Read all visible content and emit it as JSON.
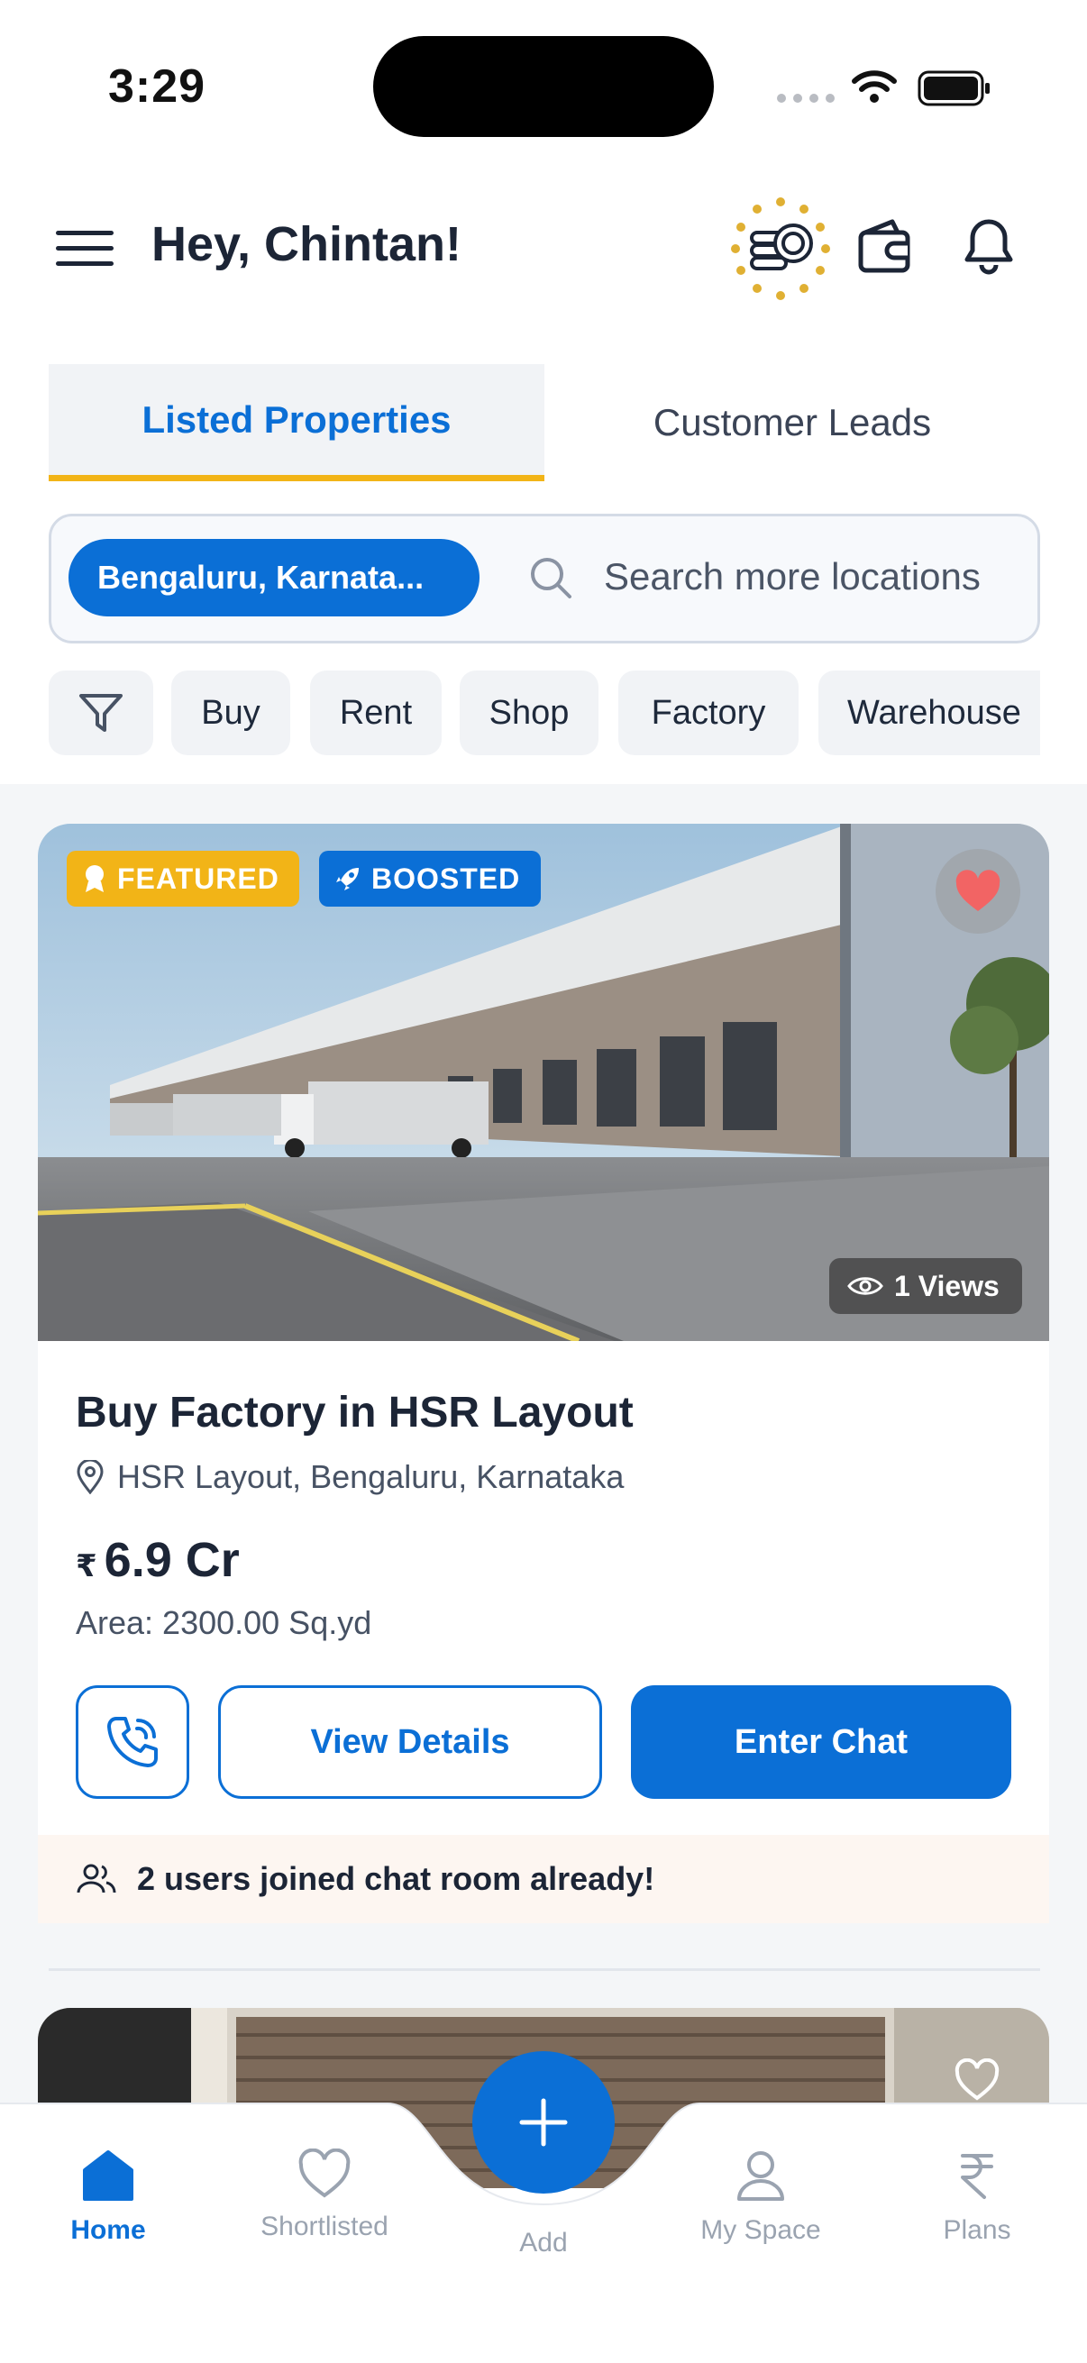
{
  "status_bar": {
    "time": "3:29"
  },
  "header": {
    "greeting": "Hey, Chintan!"
  },
  "tabs": [
    {
      "label": "Listed Properties",
      "active": true
    },
    {
      "label": "Customer Leads",
      "active": false
    }
  ],
  "search": {
    "location_chip": "Bengaluru, Karnata...",
    "placeholder": "Search more locations"
  },
  "filters": [
    "Buy",
    "Rent",
    "Shop",
    "Factory",
    "Warehouse"
  ],
  "listing": {
    "badges": {
      "featured": "FEATURED",
      "boosted": "BOOSTED"
    },
    "views": "1 Views",
    "title": "Buy Factory in HSR Layout",
    "location": "HSR Layout, Bengaluru, Karnataka",
    "currency_symbol": "₹",
    "price": "6.9 Cr",
    "area": "Area: 2300.00 Sq.yd",
    "buttons": {
      "view_details": "View Details",
      "enter_chat": "Enter Chat"
    },
    "joined_text": "2 users joined chat room already!"
  },
  "bottom_nav": {
    "home": "Home",
    "shortlisted": "Shortlisted",
    "add": "Add",
    "my_space": "My Space",
    "plans": "Plans"
  },
  "colors": {
    "primary": "#0b6fd6",
    "accent": "#f2b417",
    "heart": "#f26464"
  }
}
